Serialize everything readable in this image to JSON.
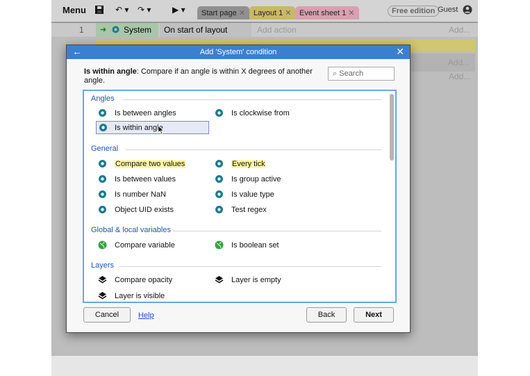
{
  "toolbar": {
    "menu_label": "Menu",
    "save_icon": "save-icon",
    "tabs": [
      {
        "label": "Start page",
        "color": "#909090"
      },
      {
        "label": "Layout 1",
        "color": "#c9b866"
      },
      {
        "label": "Event sheet 1",
        "color": "#d9a0b0"
      }
    ],
    "edition": "Free edition",
    "user": "Guest"
  },
  "sheet": {
    "row_number": "1",
    "object": "System",
    "condition": "On start of layout",
    "add_action": "Add action",
    "add": "Add..."
  },
  "dialog": {
    "title": "Add 'System' condition",
    "description_name": "Is within angle",
    "description_text": ": Compare if an angle is within X degrees of another angle.",
    "search_placeholder": "Search",
    "categories": [
      {
        "name": "Angles",
        "items": [
          {
            "label": "Is between angles",
            "icon": "gear-icon",
            "highlighted": false,
            "selected": false
          },
          {
            "label": "Is clockwise from",
            "icon": "gear-icon",
            "highlighted": false,
            "selected": false
          },
          {
            "label": "Is within angle",
            "icon": "gear-icon",
            "highlighted": false,
            "selected": true
          }
        ]
      },
      {
        "name": "General",
        "items": [
          {
            "label": "Compare two values",
            "icon": "gear-icon",
            "highlighted": true,
            "selected": false
          },
          {
            "label": "Every tick",
            "icon": "gear-icon",
            "highlighted": true,
            "selected": false
          },
          {
            "label": "Is between values",
            "icon": "gear-icon",
            "highlighted": false,
            "selected": false
          },
          {
            "label": "Is group active",
            "icon": "gear-icon",
            "highlighted": false,
            "selected": false
          },
          {
            "label": "Is number NaN",
            "icon": "gear-icon",
            "highlighted": false,
            "selected": false
          },
          {
            "label": "Is value type",
            "icon": "gear-icon",
            "highlighted": false,
            "selected": false
          },
          {
            "label": "Object UID exists",
            "icon": "gear-icon",
            "highlighted": false,
            "selected": false
          },
          {
            "label": "Test regex",
            "icon": "gear-icon",
            "highlighted": false,
            "selected": false
          }
        ]
      },
      {
        "name": "Global & local variables",
        "items": [
          {
            "label": "Compare variable",
            "icon": "globe-icon",
            "highlighted": false,
            "selected": false
          },
          {
            "label": "Is boolean set",
            "icon": "globe-icon",
            "highlighted": false,
            "selected": false
          }
        ]
      },
      {
        "name": "Layers",
        "items": [
          {
            "label": "Compare opacity",
            "icon": "layers-icon",
            "highlighted": false,
            "selected": false
          },
          {
            "label": "Layer is empty",
            "icon": "layers-icon",
            "highlighted": false,
            "selected": false
          },
          {
            "label": "Layer is visible",
            "icon": "layers-icon",
            "highlighted": false,
            "selected": false
          }
        ]
      }
    ],
    "buttons": {
      "cancel": "Cancel",
      "help": "Help",
      "back": "Back",
      "next": "Next"
    },
    "colors": {
      "header": "#3b7fd0",
      "category": "#2255a5",
      "gear": "#1f7a8c",
      "globe": "#3aa040",
      "highlight": "#fff6a6"
    }
  }
}
